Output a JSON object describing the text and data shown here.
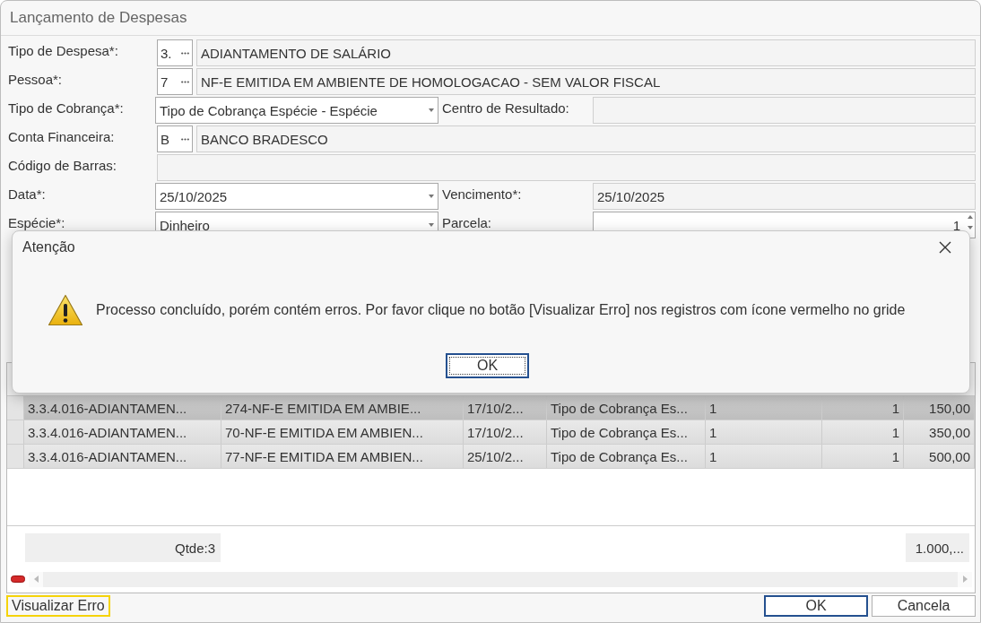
{
  "window": {
    "title": "Lançamento de Despesas"
  },
  "form": {
    "rows": [
      {
        "kind": "lookup",
        "label": "Tipo de Despesa*:",
        "code": "3.",
        "value": "ADIANTAMENTO DE SALÁRIO"
      },
      {
        "kind": "lookup",
        "label": "Pessoa*:",
        "code": "7",
        "value": "NF-E EMITIDA EM AMBIENTE DE HOMOLOGACAO - SEM VALOR FISCAL"
      },
      {
        "kind": "pair",
        "label": "Tipo de Cobrança*:",
        "value": "Tipo de Cobrança Espécie - Espécie",
        "editable": true,
        "dropdown": true,
        "label2": "Centro de Resultado:",
        "editable2": false
      },
      {
        "kind": "lookup",
        "label": "Conta Financeira:",
        "code": "B",
        "value": "BANCO BRADESCO"
      },
      {
        "kind": "text",
        "label": "Código de Barras:",
        "editable": false
      },
      {
        "kind": "pair",
        "label": "Data*:",
        "value": "25/10/2025",
        "editable": true,
        "dropdown": true,
        "label2": "Vencimento*:",
        "value2": "25/10/2025",
        "editable2": false
      },
      {
        "kind": "pair",
        "label": "Espécie*:",
        "value": "Dinheiro",
        "editable": true,
        "dropdown": true,
        "label2": "Parcela:",
        "value2": "1",
        "editable2": true,
        "spin2": true
      }
    ]
  },
  "grid": {
    "rows": [
      {
        "selected": true,
        "cells": [
          "3.3.4.016-ADIANTAMEN...",
          "274-NF-E EMITIDA EM AMBIE...",
          "17/10/2...",
          "Tipo de Cobrança Es...",
          "1",
          "1",
          "150,00"
        ]
      },
      {
        "selected": false,
        "cells": [
          "3.3.4.016-ADIANTAMEN...",
          "70-NF-E EMITIDA EM AMBIEN...",
          "17/10/2...",
          "Tipo de Cobrança Es...",
          "1",
          "1",
          "350,00"
        ]
      },
      {
        "selected": false,
        "cells": [
          "3.3.4.016-ADIANTAMEN...",
          "77-NF-E EMITIDA EM AMBIEN...",
          "25/10/2...",
          "Tipo de Cobrança Es...",
          "1",
          "1",
          "500,00"
        ]
      }
    ],
    "footer": {
      "count": "Qtde:3",
      "total": "1.000,..."
    }
  },
  "buttons": [
    {
      "kind": "link",
      "label": "Visualizar Erro",
      "focused": true
    },
    {
      "kind": "push",
      "label": "OK",
      "default": true
    },
    {
      "kind": "push",
      "label": "Cancela",
      "default": false
    }
  ],
  "dialog": {
    "title": "Atenção",
    "message": "Processo concluído, porém contém erros. Por favor clique no botão [Visualizar Erro] nos registros com ícone vermelho no gride",
    "button": {
      "label": "OK",
      "default": true
    }
  }
}
